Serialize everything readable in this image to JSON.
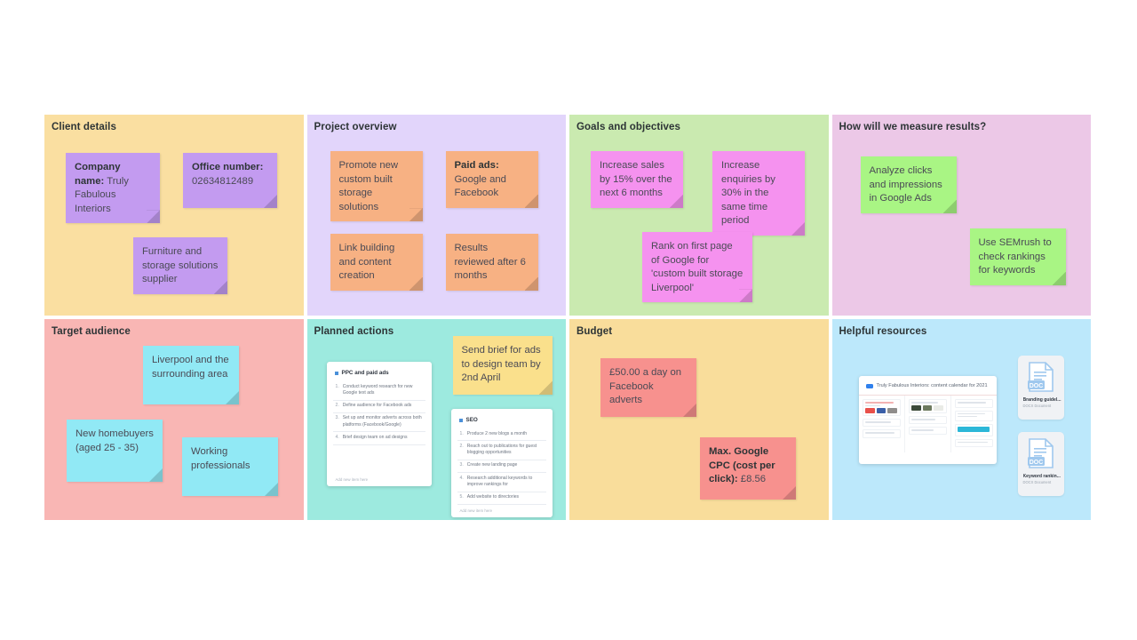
{
  "board": {
    "panels": [
      {
        "id": "client-details",
        "title": "Client details",
        "bg": "#fadfa1",
        "note_bg": "#c39bf0",
        "notes": [
          {
            "bold": "Company name:",
            "text": "Truly Fabulous Interiors"
          },
          {
            "bold": "Office number:",
            "text": "02634812489"
          },
          {
            "bold": "",
            "text": "Furniture and storage solutions supplier"
          }
        ]
      },
      {
        "id": "project-overview",
        "title": "Project overview",
        "bg": "#e2d5fb",
        "note_bg": "#f7b183",
        "notes": [
          {
            "bold": "",
            "text": "Promote new custom built storage solutions"
          },
          {
            "bold": "Paid ads:",
            "text": "Google and Facebook"
          },
          {
            "bold": "",
            "text": "Link building and content creation"
          },
          {
            "bold": "",
            "text": "Results reviewed after 6 months"
          }
        ]
      },
      {
        "id": "goals-and-objectives",
        "title": "Goals and objectives",
        "bg": "#caeab0",
        "note_bg": "#f592ef",
        "notes": [
          {
            "bold": "",
            "text": "Increase sales by 15% over the next 6 months"
          },
          {
            "bold": "",
            "text": "Increase enquiries by 30% in the same time period"
          },
          {
            "bold": "",
            "text": "Rank on first page of Google for 'custom built storage Liverpool'"
          }
        ]
      },
      {
        "id": "how-will-we-measure-results",
        "title": "How will we measure results?",
        "bg": "#ecc8e7",
        "note_bg": "#a9f584",
        "notes": [
          {
            "bold": "",
            "text": "Analyze clicks and impressions in Google Ads"
          },
          {
            "bold": "",
            "text": "Use SEMrush to check rankings for keywords"
          }
        ]
      },
      {
        "id": "target-audience",
        "title": "Target audience",
        "bg": "#f9b6b4",
        "note_bg": "#91e9f5",
        "notes": [
          {
            "bold": "",
            "text": "Liverpool and the surrounding area"
          },
          {
            "bold": "",
            "text": "New homebuyers (aged 25 - 35)"
          },
          {
            "bold": "",
            "text": "Working professionals"
          }
        ]
      },
      {
        "id": "planned-actions",
        "title": "Planned actions",
        "bg": "#9deadf",
        "note_bg": "#fae08c",
        "notes": [
          {
            "bold": "",
            "text": "Send brief for ads to design team by 2nd April"
          }
        ]
      },
      {
        "id": "budget",
        "title": "Budget",
        "bg": "#f9dd9b",
        "note_bg": "#f7918e",
        "notes": [
          {
            "bold": "",
            "text": "£50.00 a day on Facebook adverts"
          },
          {
            "bold": "Max. Google CPC (cost per click):",
            "text": "£8.56"
          }
        ]
      },
      {
        "id": "helpful-resources",
        "title": "Helpful resources",
        "bg": "#bce8fb",
        "note_bg": "#bce8fb",
        "notes": []
      }
    ]
  },
  "checklists": [
    {
      "id": "ppc-and-paid-ads",
      "title": "PPC and paid ads",
      "items": [
        "Conduct keyword research for new Google text ads",
        "Define audience for Facebook ads",
        "Set up and monitor adverts across both platforms (Facebook/Google)",
        "Brief design team on ad designs"
      ],
      "footer": "Add new item here"
    },
    {
      "id": "seo",
      "title": "SEO",
      "items": [
        "Produce 2 new blogs a month",
        "Reach out to publications for guest blogging opportunities",
        "Create new landing page",
        "Research additional keywords to improve rankings for",
        "Add website to directories"
      ],
      "footer": "Add new item here"
    }
  ],
  "calendar": {
    "title": "Truly Fabulous Interiors: content calendar for 2021"
  },
  "documents": [
    {
      "name": "Branding guidel...",
      "kind": "DOCX Document",
      "badge": "DOC"
    },
    {
      "name": "Keyword rankin...",
      "kind": "DOCX Document",
      "badge": "DOC"
    }
  ]
}
